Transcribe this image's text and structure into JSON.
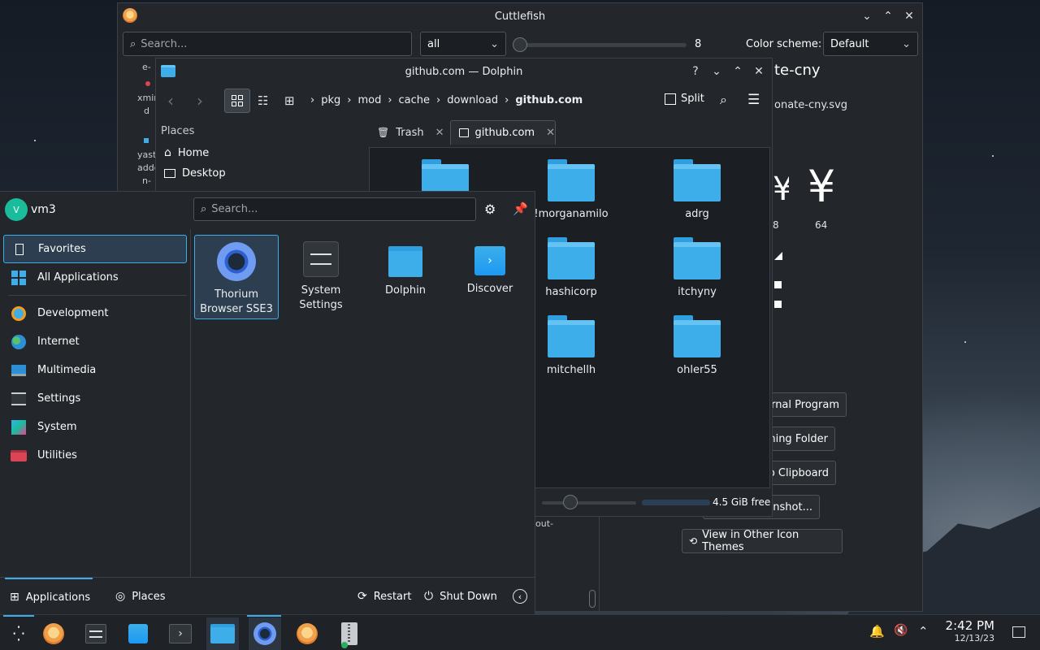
{
  "cuttlefish": {
    "title": "Cuttlefish",
    "search_placeholder": "Search...",
    "filter_value": "all",
    "slider_value": "8",
    "color_scheme_label": "Color scheme:",
    "color_scheme_value": "Default",
    "side_items": [
      "e-",
      "xmin",
      "d",
      "yast-",
      "addo",
      "n-"
    ],
    "heading_partial": "te-cny",
    "file_partial": "onate-cny.svg",
    "preview_label_a": "8",
    "preview_label_b": "64",
    "preview_glyph_b": "¥",
    "buttons": {
      "external": "rnal Program",
      "folder": "ning Folder",
      "clipboard": "o Clipboard",
      "screenshot": "enshot...",
      "icon_themes": "View in Other Icon Themes"
    },
    "bottom_partial": "out-"
  },
  "dolphin": {
    "title": "github.com — Dolphin",
    "breadcrumb": [
      "pkg",
      "mod",
      "cache",
      "download",
      "github.com"
    ],
    "split_label": "Split",
    "places_header": "Places",
    "places": [
      "Home",
      "Desktop"
    ],
    "tabs": [
      "Trash",
      "github.com"
    ],
    "folders": [
      "!morganamilo",
      "adrg",
      "hashicorp",
      "itchyny",
      "mitchellh",
      "ohler55"
    ],
    "free_space": "4.5 GiB free",
    "zoom_fraction": 0.27
  },
  "launcher": {
    "user_initial": "V",
    "user_name": "vm3",
    "search_placeholder": "Search...",
    "categories": [
      "Favorites",
      "All Applications",
      "Development",
      "Internet",
      "Multimedia",
      "Settings",
      "System",
      "Utilities"
    ],
    "apps": [
      {
        "name": "Thorium Browser SSE3"
      },
      {
        "name": "System Settings"
      },
      {
        "name": "Dolphin"
      },
      {
        "name": "Discover"
      }
    ],
    "footer": {
      "applications": "Applications",
      "places": "Places",
      "restart": "Restart",
      "shutdown": "Shut Down"
    }
  },
  "taskbar": {
    "time": "2:42 PM",
    "date": "12/13/23"
  },
  "colors": {
    "accent": "#3daee9",
    "window_bg": "#23272c",
    "selection": "#2c3e50"
  }
}
